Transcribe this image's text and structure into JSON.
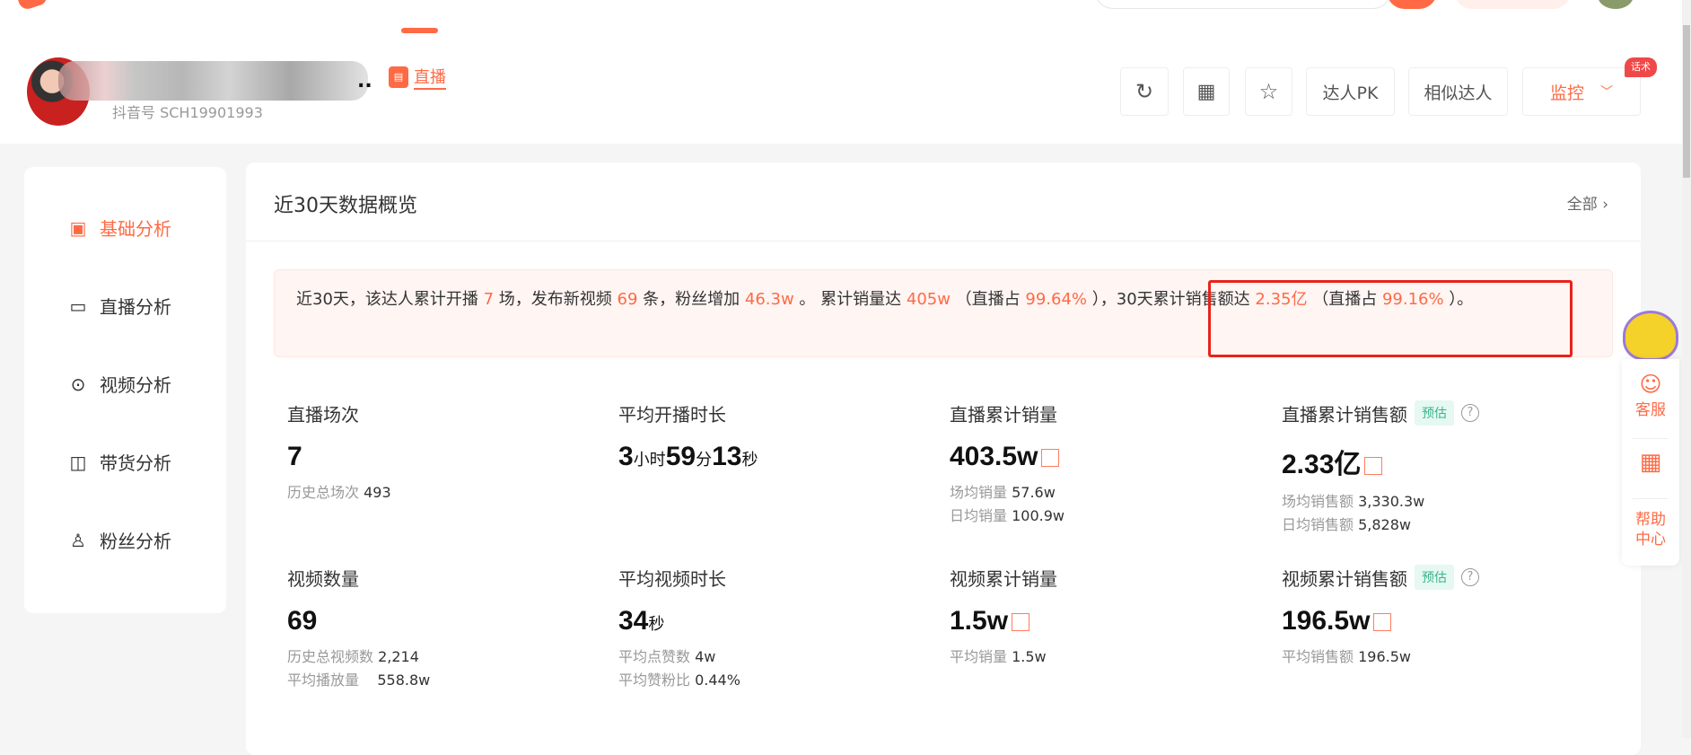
{
  "header": {
    "douyin_id": "抖音号 SCH19901993",
    "name_suffix": "..",
    "live_tag": "直播",
    "buttons": {
      "pk": "达人PK",
      "similar": "相似达人",
      "monitor": "监控",
      "monitor_badge": "话术"
    }
  },
  "sidebar": {
    "items": [
      {
        "label": "基础分析",
        "icon": "bar-chart-icon",
        "active": true
      },
      {
        "label": "直播分析",
        "icon": "live-icon"
      },
      {
        "label": "视频分析",
        "icon": "play-icon"
      },
      {
        "label": "带货分析",
        "icon": "bag-icon"
      },
      {
        "label": "粉丝分析",
        "icon": "user-icon"
      }
    ]
  },
  "main": {
    "title": "近30天数据概览",
    "all_link": "全部",
    "summary": {
      "t1": "近30天，该达人累计开播 ",
      "live_count": "7",
      "t2": " 场，发布新视频 ",
      "video_count": "69",
      "t3": " 条，粉丝增加 ",
      "fans": "46.3w",
      "t4": " 。 累计销量达 ",
      "sales": "405w",
      "t5": " （直播占 ",
      "sales_live_pct": "99.64%",
      "t6": " ），30天累计销售额达 ",
      "gmv": "2.35亿",
      "t7": " （直播占 ",
      "gmv_live_pct": "99.16%",
      "t8": " ）。"
    },
    "stats": [
      {
        "title": "直播场次",
        "value": "7",
        "subs": [
          {
            "label": "历史总场次",
            "value": "493"
          }
        ]
      },
      {
        "title": "平均开播时长",
        "value_parts": [
          "3",
          "小时",
          "59",
          "分",
          "13",
          "秒"
        ]
      },
      {
        "title": "直播累计销量",
        "value": "403.5w",
        "subs": [
          {
            "label": "场均销量",
            "value": "57.6w"
          },
          {
            "label": "日均销量",
            "value": "100.9w"
          }
        ]
      },
      {
        "title": "直播累计销售额",
        "tag": "预估",
        "value": "2.33亿",
        "subs": [
          {
            "label": "场均销售额",
            "value": "3,330.3w"
          },
          {
            "label": "日均销售额",
            "value": "5,828w"
          }
        ]
      },
      {
        "title": "视频数量",
        "value": "69",
        "subs": [
          {
            "label": "历史总视频数",
            "value": "2,214"
          },
          {
            "label": "平均播放量",
            "value": "558.8w"
          }
        ]
      },
      {
        "title": "平均视频时长",
        "value_parts": [
          "34",
          "秒"
        ],
        "subs": [
          {
            "label": "平均点赞数",
            "value": "4w"
          },
          {
            "label": "平均赞粉比",
            "value": "0.44%"
          }
        ]
      },
      {
        "title": "视频累计销量",
        "value": "1.5w",
        "subs": [
          {
            "label": "平均销量",
            "value": "1.5w"
          }
        ]
      },
      {
        "title": "视频累计销售额",
        "tag": "预估",
        "value": "196.5w",
        "subs": [
          {
            "label": "平均销售额",
            "value": "196.5w"
          }
        ]
      }
    ]
  },
  "float": {
    "service": "客服",
    "help": "帮助中心"
  },
  "colors": {
    "accent": "#ff6a45",
    "highlight_box": "#e8231c"
  }
}
